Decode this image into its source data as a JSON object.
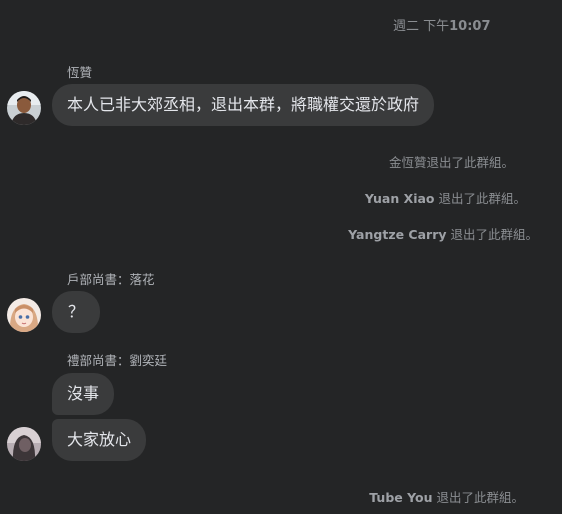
{
  "timestamp": {
    "day": "週二 下午",
    "time": "10:07"
  },
  "messages": [
    {
      "sender": "恆贊",
      "bubbles": [
        "本人已非大郊丞相，退出本群，將職權交還於政府"
      ]
    },
    {
      "sender": "戶部尚書：落花",
      "bubbles": [
        "？"
      ]
    },
    {
      "sender": "禮部尚書：劉奕廷",
      "bubbles": [
        "沒事",
        "大家放心"
      ]
    }
  ],
  "system": [
    {
      "who": "",
      "text": "金恆贊退出了此群組。"
    },
    {
      "who": "Yuan Xiao",
      "text": " 退出了此群組。"
    },
    {
      "who": "Yangtze Carry",
      "text": " 退出了此群組。"
    },
    {
      "who": "Tube You",
      "text": " 退出了此群組。"
    }
  ]
}
